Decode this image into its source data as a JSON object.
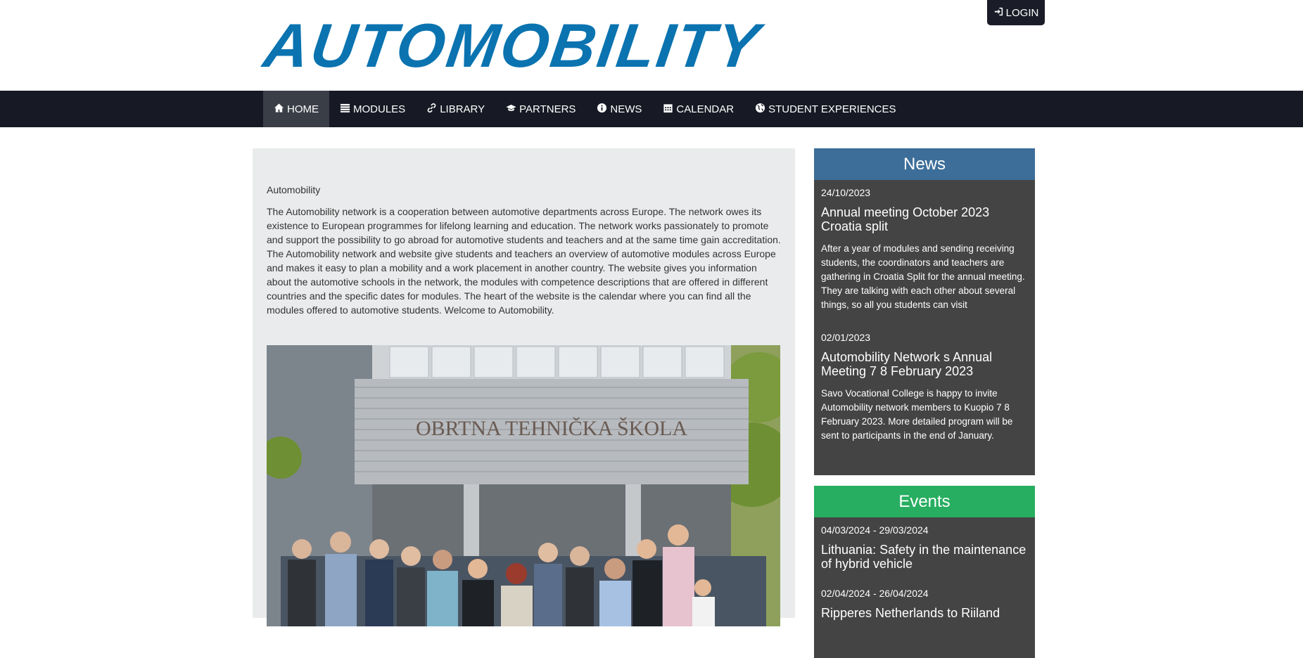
{
  "header": {
    "logo_text": "AUTOMOBILITY",
    "login_label": "LOGIN"
  },
  "nav": {
    "items": [
      {
        "label": "HOME",
        "icon": "home-icon",
        "active": true
      },
      {
        "label": "MODULES",
        "icon": "list-icon"
      },
      {
        "label": "LIBRARY",
        "icon": "link-icon"
      },
      {
        "label": "PARTNERS",
        "icon": "graduation-cap-icon"
      },
      {
        "label": "NEWS",
        "icon": "info-icon"
      },
      {
        "label": "CALENDAR",
        "icon": "calendar-icon"
      },
      {
        "label": "STUDENT EXPERIENCES",
        "icon": "globe-icon"
      }
    ]
  },
  "main": {
    "title": "Automobility",
    "text": "The Automobility network is a cooperation between automotive departments across Europe. The network owes its existence to European programmes for lifelong learning and education. The network works passionately to promote and support the possibility to go abroad for automotive students and teachers and at the same time gain accreditation. The Automobility network and website give students and teachers an overview of automotive modules across Europe and makes it easy to plan a mobility and a work placement in another country. The website gives you information about the automotive schools in the network, the modules with competence descriptions that are offered in different countries and the specific dates for modules. The heart of the website is the calendar where you can find all the modules offered to automotive students. Welcome to Automobility.",
    "photo_sign": "OBRTNA TEHNIČKA ŠKOLA"
  },
  "news": {
    "heading": "News",
    "items": [
      {
        "date": "24/10/2023",
        "title": "Annual meeting October 2023 Croatia split",
        "text": "After a year of modules and sending receiving students, the coordinators and teachers are gathering in Croatia Split for the annual meeting. They are talking with each other about several things, so all you students can visit"
      },
      {
        "date": "02/01/2023",
        "title": "Automobility Network s Annual Meeting 7 8 February 2023",
        "text": "Savo Vocational College is happy to invite Automobility network members to Kuopio 7 8 February 2023. More detailed program will be sent to participants in the end of January."
      }
    ]
  },
  "events": {
    "heading": "Events",
    "items": [
      {
        "date": "04/03/2024 - 29/03/2024",
        "title": "Lithuania: Safety in the maintenance of hybrid vehicle"
      },
      {
        "date": "02/04/2024 - 26/04/2024",
        "title": "Ripperes Netherlands to Riiland"
      }
    ]
  },
  "colors": {
    "brand_blue": "#0a73b0",
    "nav_bg": "#171a24",
    "news_head": "#3d6e99",
    "events_head": "#27ae60",
    "sidebar_body": "#444444"
  }
}
